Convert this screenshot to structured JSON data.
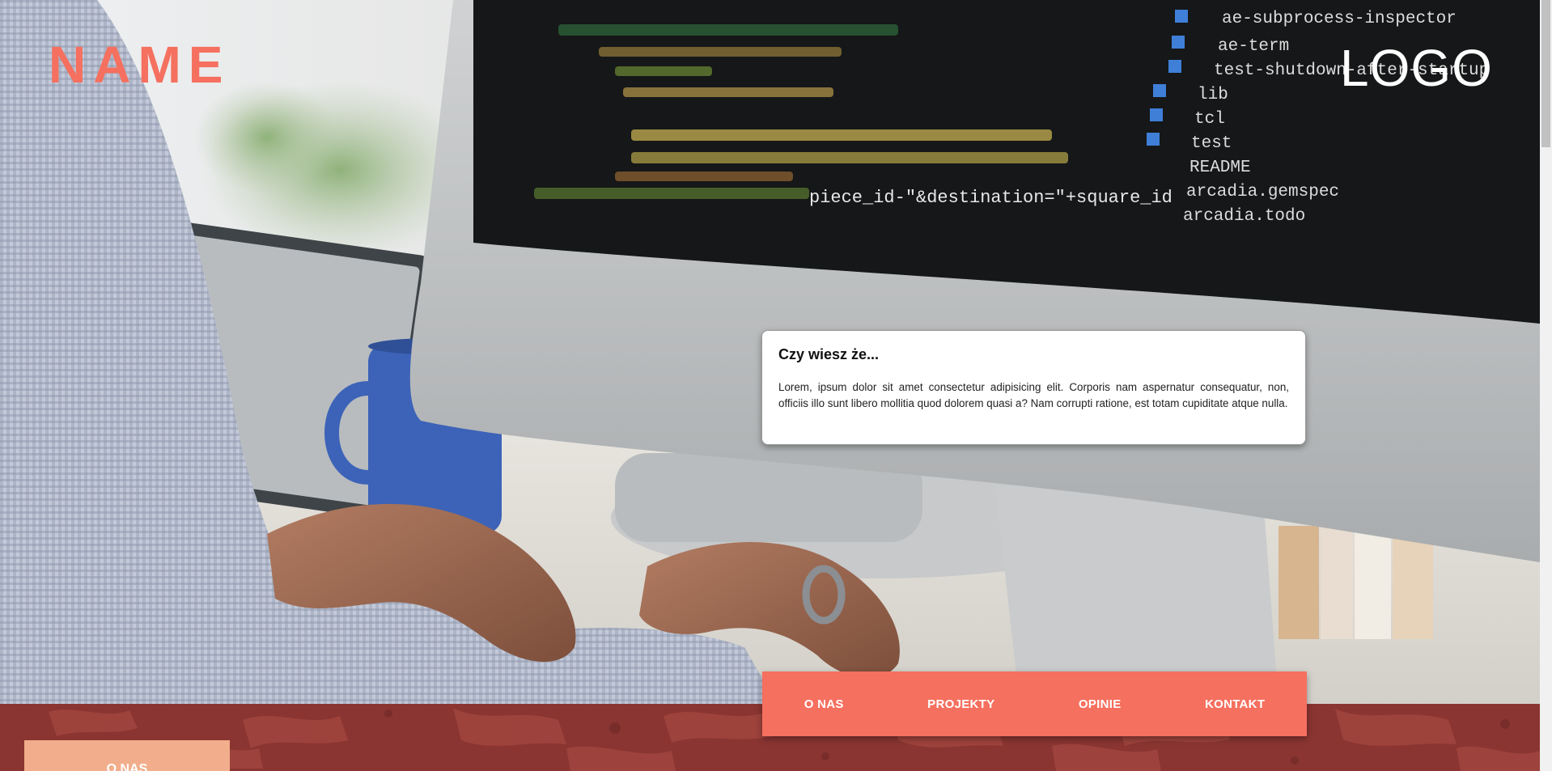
{
  "header": {
    "brand_name": "NAME",
    "logo_text": "LOGO"
  },
  "fact_card": {
    "title": "Czy wiesz że...",
    "text": "Lorem, ipsum dolor sit amet consectetur adipisicing elit. Corporis nam aspernatur consequatur, non, officiis illo sunt libero mollitia quod dolorem quasi a? Nam corrupti ratione, est totam cupiditate atque nulla."
  },
  "nav": {
    "items": [
      {
        "label": "O NAS"
      },
      {
        "label": "PROJEKTY"
      },
      {
        "label": "OPINIE"
      },
      {
        "label": "KONTAKT"
      }
    ]
  },
  "section": {
    "about_tab_label": "O NAS"
  },
  "screen_code": {
    "tree_items": [
      "ae-subprocess-inspector",
      "ae-term",
      "test-shutdown-after-startup",
      "lib",
      "tcl",
      "test",
      "README",
      "arcadia.gemspec",
      "arcadia.todo"
    ],
    "code_line": "piece_id-\"&destination=\"+square_id"
  },
  "colors": {
    "accent": "#f5705f",
    "band": "#8a3532",
    "tab": "#f2ae8c"
  }
}
